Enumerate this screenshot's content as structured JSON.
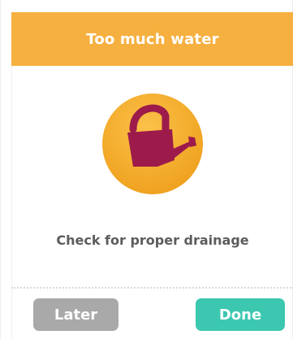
{
  "dialog": {
    "title": "Too much water",
    "icon": "watering-can-icon",
    "message": "Check for proper drainage"
  },
  "actions": {
    "later_label": "Later",
    "done_label": "Done"
  },
  "colors": {
    "header": "#f6b040",
    "icon_circle": "#f2a723",
    "icon_can": "#9c1b4b",
    "later_button": "#a9a9a9",
    "done_button": "#3cc7b0",
    "message_text": "#5c5c5c"
  }
}
